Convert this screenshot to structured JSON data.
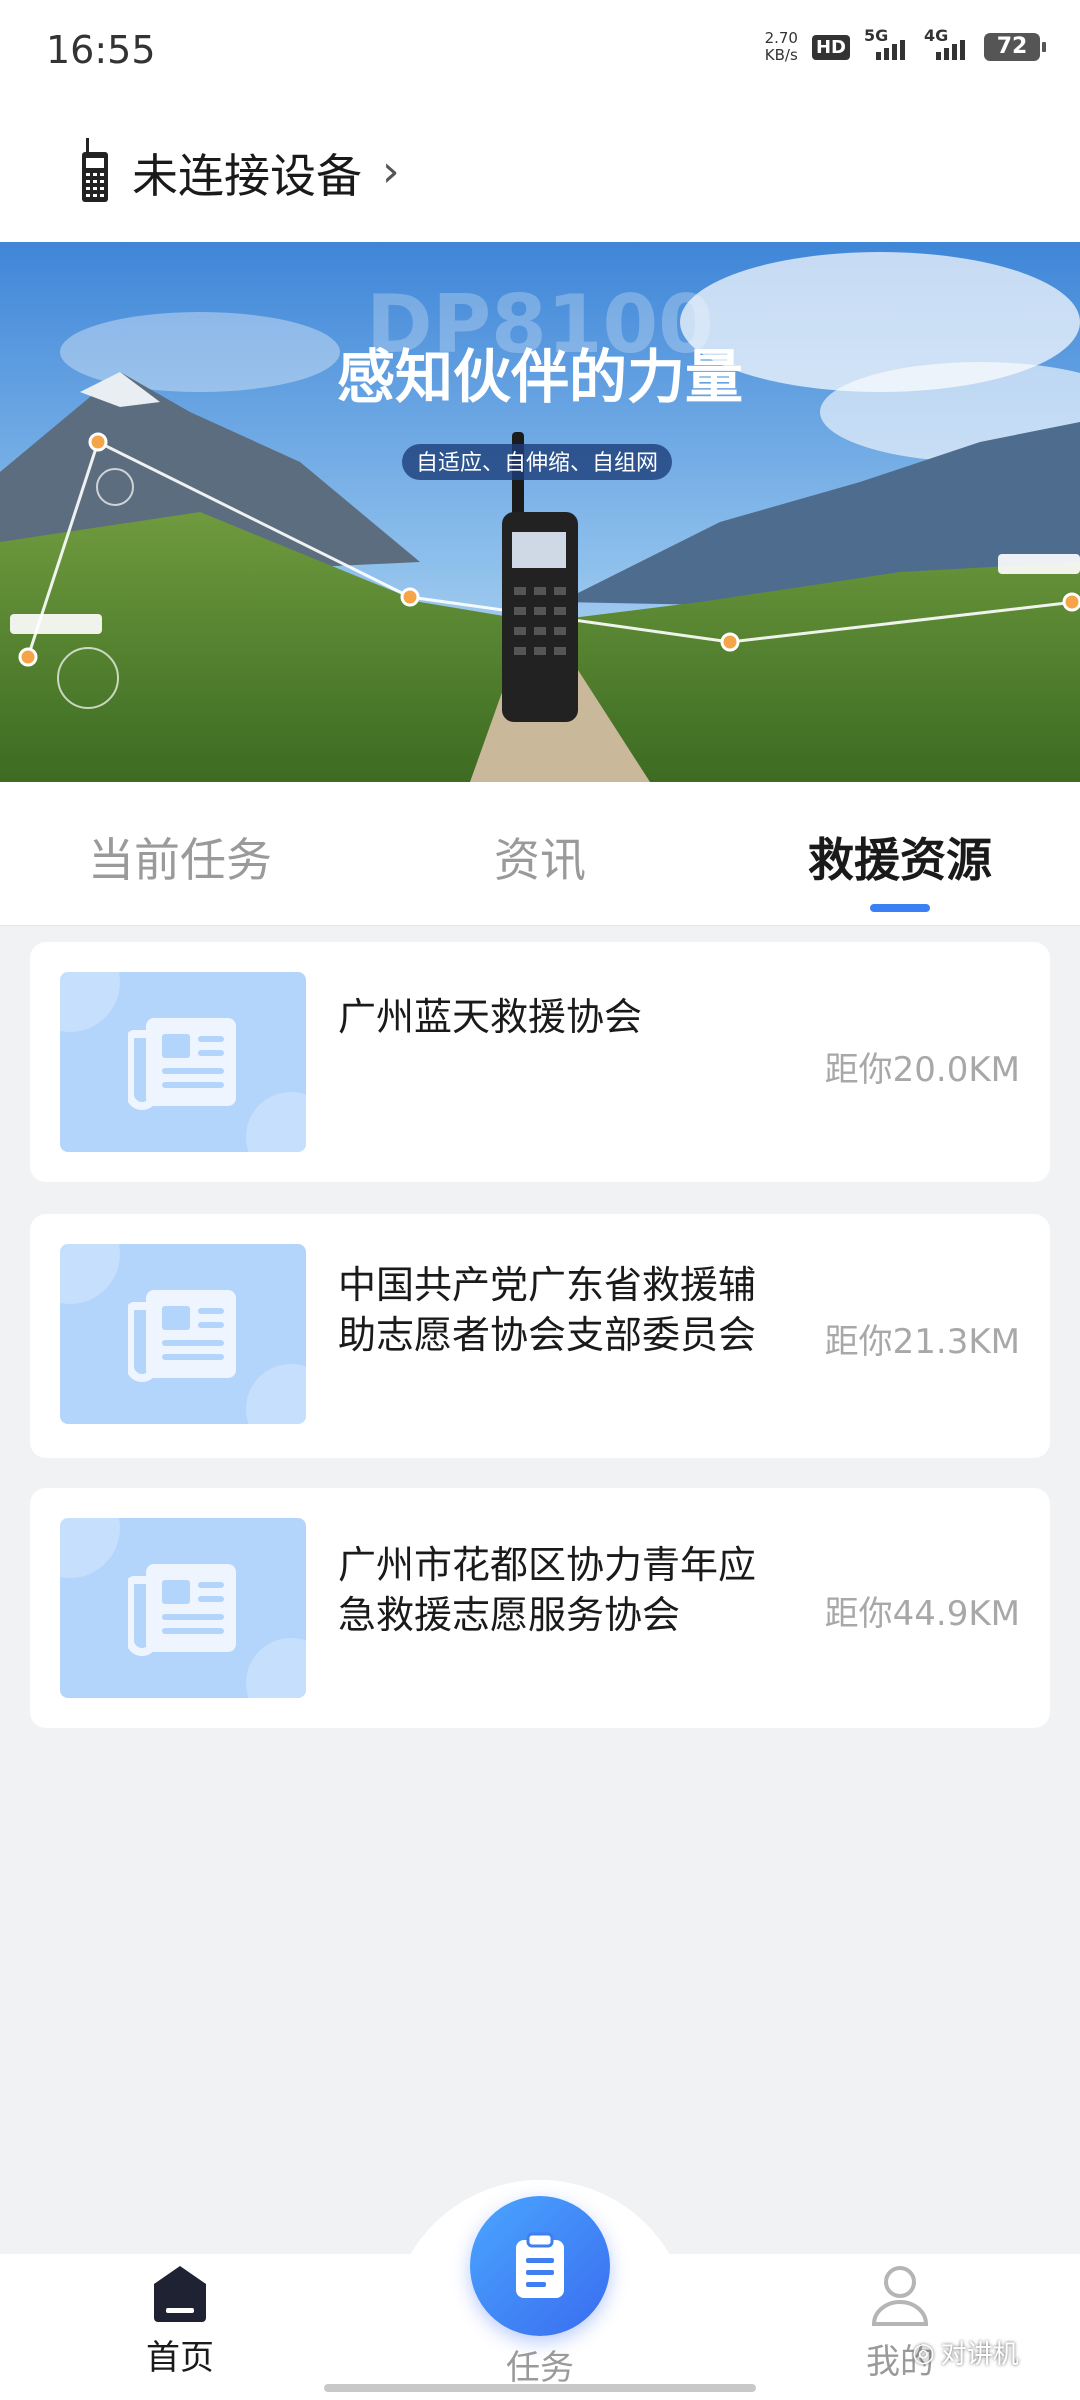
{
  "status_bar": {
    "time": "16:55",
    "net_speed_value": "2.70",
    "net_speed_unit": "KB/s",
    "hd_label": "HD",
    "sim1_network": "5G",
    "sim2_network": "4G",
    "battery": "72"
  },
  "header": {
    "title": "未连接设备",
    "chevron": "›",
    "icon": "walkie-talkie-icon"
  },
  "banner": {
    "headline": "感知伙伴的力量",
    "subline": "自适应、自伸缩、自组网",
    "model_watermark": "DP8100"
  },
  "tabs": [
    {
      "label": "当前任务",
      "active": false
    },
    {
      "label": "资讯",
      "active": false
    },
    {
      "label": "救援资源",
      "active": true
    }
  ],
  "accent_color": "#3b7ff5",
  "resources": [
    {
      "name": "广州蓝天救援协会",
      "distance": "距你20.0KM"
    },
    {
      "name": "中国共产党广东省救援辅助志愿者协会支部委员会",
      "distance": "距你21.3KM"
    },
    {
      "name": "广州市花都区协力青年应急救援志愿服务协会",
      "distance": "距你44.9KM"
    }
  ],
  "bottom_nav": {
    "home": "首页",
    "task": "任务",
    "me": "我的"
  },
  "watermark": "对讲机"
}
